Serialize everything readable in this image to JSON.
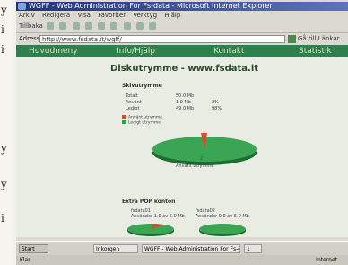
{
  "bleed": {
    "chars": [
      "y",
      "i",
      "i",
      "y",
      "y",
      "i"
    ]
  },
  "window": {
    "title": "WGFF - Web Administration For Fs-data - Microsoft Internet Explorer"
  },
  "menu": [
    "Arkiv",
    "Redigera",
    "Visa",
    "Favoriter",
    "Verktyg",
    "Hjälp"
  ],
  "toolbar": {
    "back_label": "Tillbaka"
  },
  "address": {
    "label": "Adress",
    "url": "http://www.fsdata.it/wgff/",
    "go_label": "Gå till",
    "links_label": "Länkar"
  },
  "nav": [
    "Huvudmeny",
    "Info/Hjälp",
    "Kontakt",
    "Statistik"
  ],
  "page": {
    "title": "Diskutrymme - www.fsdata.it",
    "section": "Skivutrymme",
    "rows": [
      {
        "label": "Totalt",
        "value": "50.0 Mb",
        "pct": ""
      },
      {
        "label": "Använt",
        "value": "1.0 Mb",
        "pct": "2%"
      },
      {
        "label": "Ledigt",
        "value": "49.0 Mb",
        "pct": "98%"
      }
    ],
    "legend": [
      {
        "label": "Använt utrymme",
        "color": "#d64a2e"
      },
      {
        "label": "Ledigt utrymme",
        "color": "#2f9e4a"
      }
    ],
    "pie_number": "2",
    "pie_caption": "Använt utrymme",
    "pop_section": "Extra POP konton",
    "pop": [
      {
        "name": "fsdata01",
        "usage": "Använder 1.0 av 5.0 Mb"
      },
      {
        "name": "fsdata02",
        "usage": "Använder 0.0 av 5.0 Mb"
      }
    ]
  },
  "taskbar": {
    "start": "Start",
    "tasks": [
      "Inkorgen",
      "WGFF - Web Administration For Fs-data",
      "1"
    ]
  },
  "status": {
    "left": "Klar",
    "right": "Internet"
  }
}
